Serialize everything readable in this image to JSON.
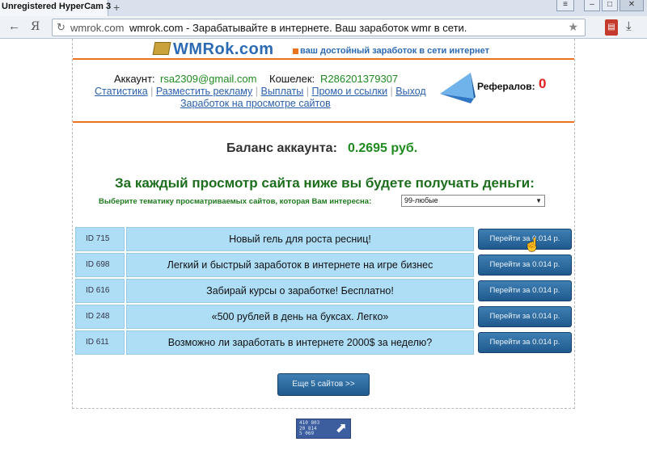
{
  "browser": {
    "tab_title": "Unregistered HyperCam 3",
    "new_tab": "+",
    "nav_ya": "Я",
    "url_domain": "wmrok.com",
    "url_page_title": "wmrok.com - Зарабатывайте в интернете. Ваш заработок wmr в сети."
  },
  "site": {
    "logo_text": "WMRok.com",
    "slogan": "ваш достойный заработок в сети интернет"
  },
  "account": {
    "account_label": "Аккаунт:",
    "account_value": "rsa2309@gmail.com",
    "wallet_label": "Кошелек:",
    "wallet_value": "R286201379307",
    "links": [
      "Статистика",
      "Разместить рекламу",
      "Выплаты",
      "Промо и ссылки",
      "Выход"
    ],
    "link_views": "Заработок на просмотре сайтов",
    "referrals_label": "Рефералов:",
    "referrals_value": "0"
  },
  "balance": {
    "label": "Баланс аккаунта:",
    "value": "0.2695 руб."
  },
  "main": {
    "headline": "За каждый просмотр сайта ниже вы будете получать деньги:",
    "theme_label": "Выберите тематику просматриваемых сайтов, которая Вам интересна:",
    "theme_selected": "99-любые",
    "rows": [
      {
        "id": "ID 715",
        "title": "Новый гель для роста ресниц!",
        "button": "Перейти за 0.014 р."
      },
      {
        "id": "ID 698",
        "title": "Легкий и быстрый заработок в интернете на игре бизнес",
        "button": "Перейти за 0.014 р."
      },
      {
        "id": "ID 616",
        "title": "Забирай курсы о заработке! Бесплатно!",
        "button": "Перейти за 0.014 р."
      },
      {
        "id": "ID 248",
        "title": "«500 рублей в день на буксах. Легко»",
        "button": "Перейти за 0.014 р."
      },
      {
        "id": "ID 611",
        "title": "Возможно ли заработать в интернете 2000$ за неделю?",
        "button": "Перейти за 0.014 р."
      }
    ],
    "more_button": "Еще 5 сайтов >>"
  },
  "counter": {
    "lines": [
      "410 803",
      "20 814",
      "5 069"
    ]
  }
}
